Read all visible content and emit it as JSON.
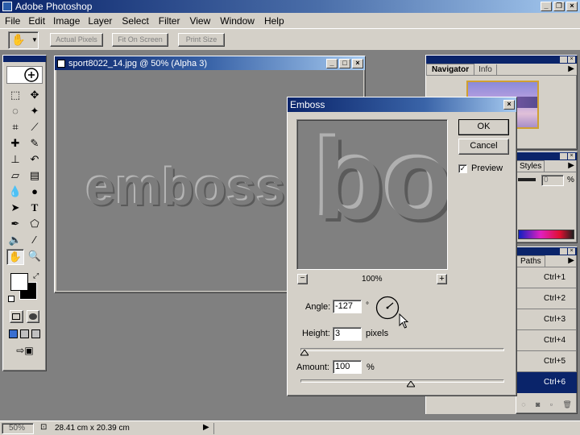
{
  "app": {
    "title": "Adobe Photoshop"
  },
  "menubar": {
    "items": [
      "File",
      "Edit",
      "Image",
      "Layer",
      "Select",
      "Filter",
      "View",
      "Window",
      "Help"
    ]
  },
  "options_bar": {
    "buttons": [
      "Actual Pixels",
      "Fit On Screen",
      "Print Size"
    ]
  },
  "document": {
    "title": "sport8022_14.jpg @ 50% (Alpha 3)",
    "emboss_text": "emboss"
  },
  "navigator": {
    "tabs": [
      "Navigator",
      "Info"
    ]
  },
  "styles_panel": {
    "tab": "Styles",
    "opacity_value": "0",
    "opacity_unit": "%"
  },
  "channels_panel": {
    "tab": "Paths",
    "rows": [
      "Ctrl+1",
      "Ctrl+2",
      "Ctrl+3",
      "Ctrl+4",
      "Ctrl+5",
      "Ctrl+6"
    ]
  },
  "dialog": {
    "title": "Emboss",
    "ok_label": "OK",
    "cancel_label": "Cancel",
    "preview_label": "Preview",
    "preview_checked": true,
    "preview_text": "bo",
    "zoom": "100%",
    "zoom_minus": "−",
    "zoom_plus": "+",
    "angle_label": "Angle:",
    "angle_value": "-127",
    "angle_unit": "°",
    "height_label": "Height:",
    "height_value": "3",
    "height_unit": "pixels",
    "height_slider": 0.02,
    "amount_label": "Amount:",
    "amount_value": "100",
    "amount_unit": "%",
    "amount_slider": 0.54
  },
  "statusbar": {
    "zoom": "50%",
    "doc_size": "28.41 cm x 20.39 cm"
  }
}
